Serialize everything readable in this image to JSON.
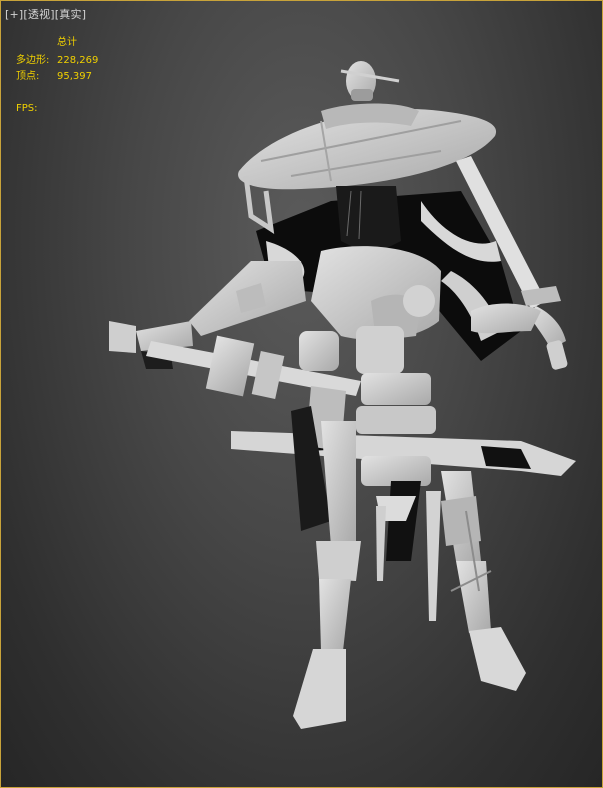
{
  "viewport": {
    "label_plus": "[+]",
    "label_view": "[透视]",
    "label_shading": "[真实]"
  },
  "stats": {
    "title": "总计",
    "polygons_label": "多边形:",
    "polygons_value": "228,269",
    "vertices_label": "顶点:",
    "vertices_value": "95,397",
    "fps_label": "FPS:"
  },
  "colors": {
    "viewport_border": "#c8a33a",
    "stats_text": "#f0d000",
    "label_text": "#d4d4d4",
    "model_clay": "#c9c9c9"
  }
}
